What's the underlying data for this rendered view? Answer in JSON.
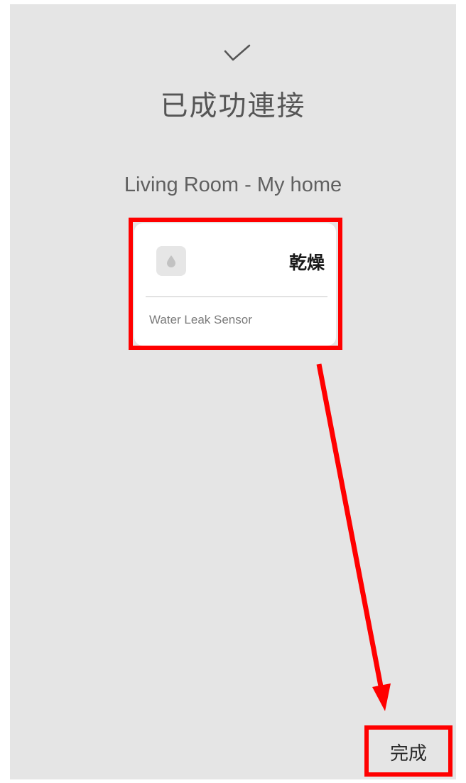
{
  "status": {
    "icon": "checkmark-icon",
    "title": "已成功連接"
  },
  "location": {
    "label": "Living Room - My home"
  },
  "device": {
    "icon": "water-drop-icon",
    "state": "乾燥",
    "name": "Water Leak Sensor"
  },
  "actions": {
    "done_label": "完成"
  },
  "annotations": {
    "highlight_color": "#ff0000",
    "arrow_color": "#ff0000"
  },
  "colors": {
    "background": "#e5e5e5",
    "card": "#ffffff"
  }
}
